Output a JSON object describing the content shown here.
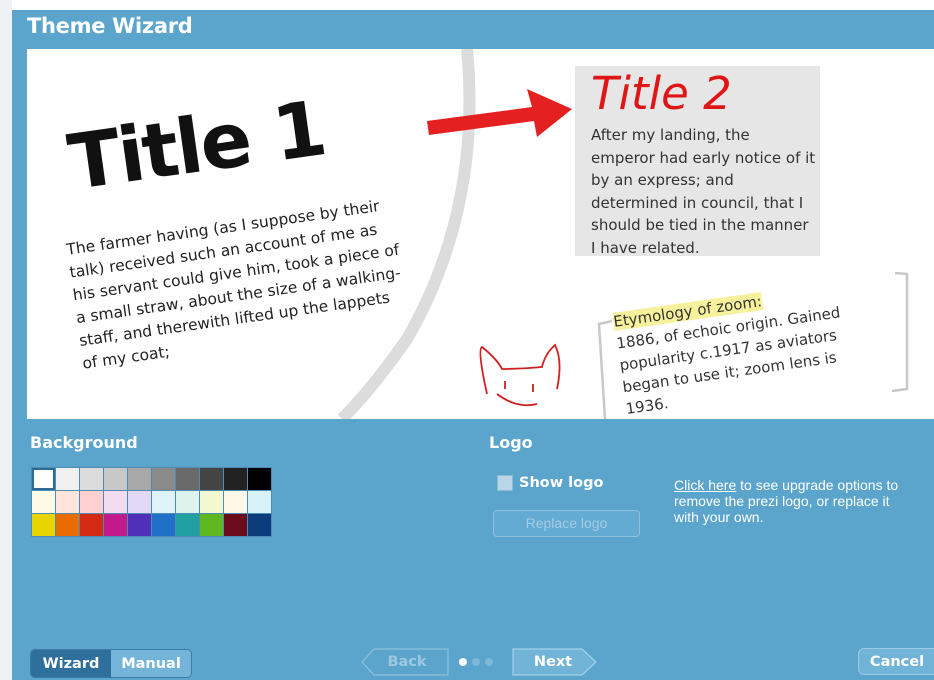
{
  "window": {
    "title": "Theme Wizard"
  },
  "preview": {
    "title1": "Title 1",
    "paragraph1": "The farmer having (as I suppose by their talk) received such an account of me as his servant could give him, took a piece of a small straw, about the size of a walking-staff, and therewith lifted up the lappets of my coat;",
    "title2": "Title 2",
    "paragraph2": "After my landing, the emperor had early notice of it by an express; and determined in council, that I should be tied in the manner I have related.",
    "quote_heading": "Etymology of zoom:",
    "quote_body": "1886, of echoic origin. Gained popularity c.1917 as aviators began to use it; zoom lens is 1936.",
    "colors": {
      "title2": "#e01616",
      "arrow": "#e42020",
      "highlight": "#f6f19a"
    }
  },
  "background": {
    "label": "Background",
    "selected_index": 0,
    "swatches": [
      "#ffffff",
      "#f0f0f0",
      "#dcdcdc",
      "#c8c8c8",
      "#a8a8a8",
      "#8a8a8a",
      "#6a6a6a",
      "#444444",
      "#222222",
      "#000000",
      "#fffbe6",
      "#ffe4dc",
      "#ffd0d0",
      "#f4dcf0",
      "#e0d8f4",
      "#e0f2fa",
      "#dcf4ec",
      "#f4f8d0",
      "#fff8e8",
      "#d8f2f8",
      "#e8d400",
      "#e86c00",
      "#d42a14",
      "#c01a8c",
      "#5030b8",
      "#2070c8",
      "#20a0a0",
      "#60b820",
      "#6a0c1c",
      "#0c3c7c"
    ]
  },
  "logo": {
    "label": "Logo",
    "show_logo_label": "Show logo",
    "show_logo_checked": false,
    "replace_logo_label": "Replace logo",
    "upgrade_link": "Click here",
    "upgrade_text": " to see upgrade options to remove the prezi logo, or replace it with your own."
  },
  "footer": {
    "wizard_label": "Wizard",
    "manual_label": "Manual",
    "back_label": "Back",
    "next_label": "Next",
    "cancel_label": "Cancel",
    "step_count": 3,
    "current_step": 1
  }
}
